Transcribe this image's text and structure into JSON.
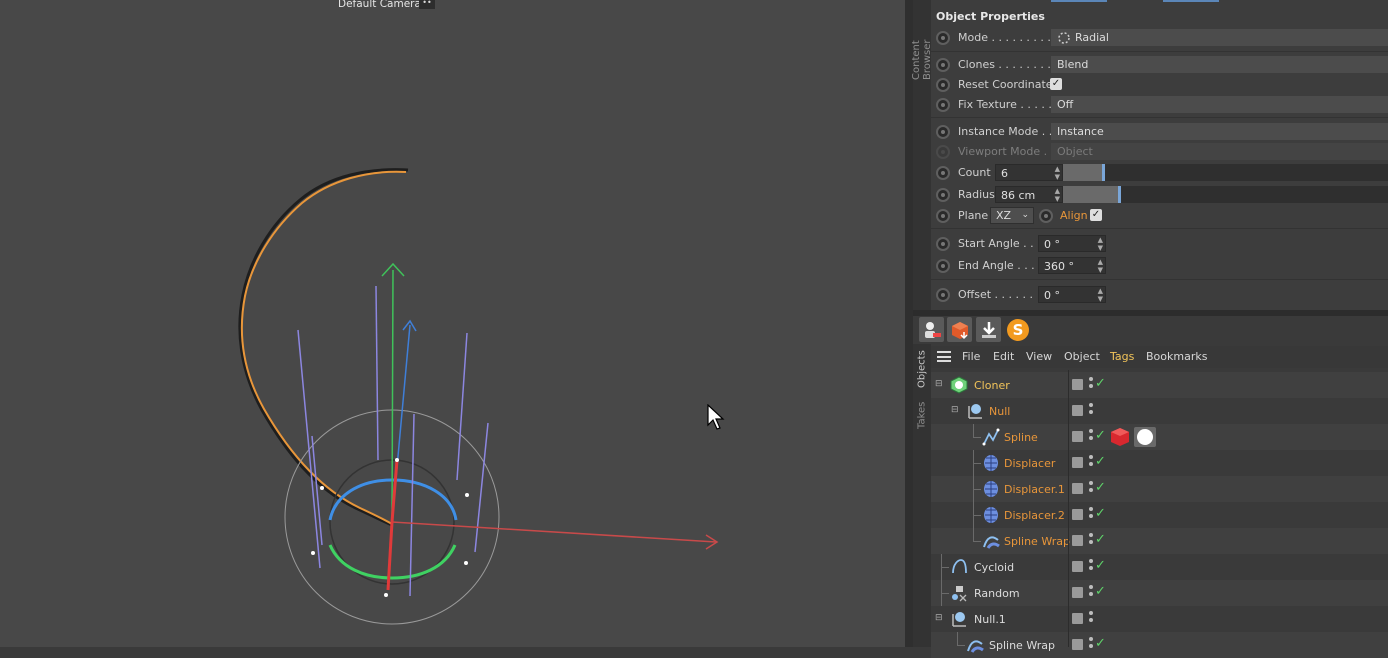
{
  "viewport": {
    "camera_label": "Default Camera",
    "camera_icon": "••"
  },
  "side_tabs": {
    "content_browser": "Content Browser",
    "objects": "Objects",
    "takes": "Takes"
  },
  "properties": {
    "title": "Object Properties",
    "mode": {
      "label": "Mode . . . . . . . . .",
      "value": "Radial"
    },
    "clones": {
      "label": "Clones . . . . . . . .",
      "value": "Blend"
    },
    "reset_coordinates": {
      "label": "Reset Coordinates",
      "checked": true
    },
    "fix_texture": {
      "label": "Fix Texture . . . . .",
      "value": "Off"
    },
    "instance_mode": {
      "label": "Instance Mode . .",
      "value": "Instance"
    },
    "viewport_mode": {
      "label": "Viewport Mode . .",
      "value": "Object"
    },
    "count": {
      "label": "Count",
      "value": "6",
      "slider_fraction": 0.1
    },
    "radius": {
      "label": "Radius",
      "value": "86 cm",
      "slider_fraction": 0.17
    },
    "plane": {
      "label": "Plane",
      "value": "XZ",
      "align_label": "Align",
      "align_checked": true
    },
    "start_angle": {
      "label": "Start Angle . .",
      "value": "0 °"
    },
    "end_angle": {
      "label": "End Angle . . .",
      "value": "360 °"
    },
    "offset": {
      "label": "Offset . . . . . .",
      "value": "0 °"
    }
  },
  "menubar": {
    "items": [
      "File",
      "Edit",
      "View",
      "Object",
      "Tags",
      "Bookmarks"
    ]
  },
  "tree": {
    "items": [
      {
        "name": "Cloner",
        "color": "yellow"
      },
      {
        "name": "Null",
        "color": "orange"
      },
      {
        "name": "Spline",
        "color": "orange"
      },
      {
        "name": "Displacer",
        "color": "orange"
      },
      {
        "name": "Displacer.1",
        "color": "orange"
      },
      {
        "name": "Displacer.2",
        "color": "orange"
      },
      {
        "name": "Spline Wrap",
        "color": "orange"
      },
      {
        "name": "Cycloid",
        "color": "white"
      },
      {
        "name": "Random",
        "color": "white"
      },
      {
        "name": "Null.1",
        "color": "white"
      },
      {
        "name": "Spline Wrap",
        "color": "white"
      }
    ]
  },
  "colors": {
    "accent_orange": "#e8963a",
    "accent_yellow": "#f2c45a",
    "check_green": "#5fd36a",
    "slider_blue": "#7aa6d8"
  }
}
